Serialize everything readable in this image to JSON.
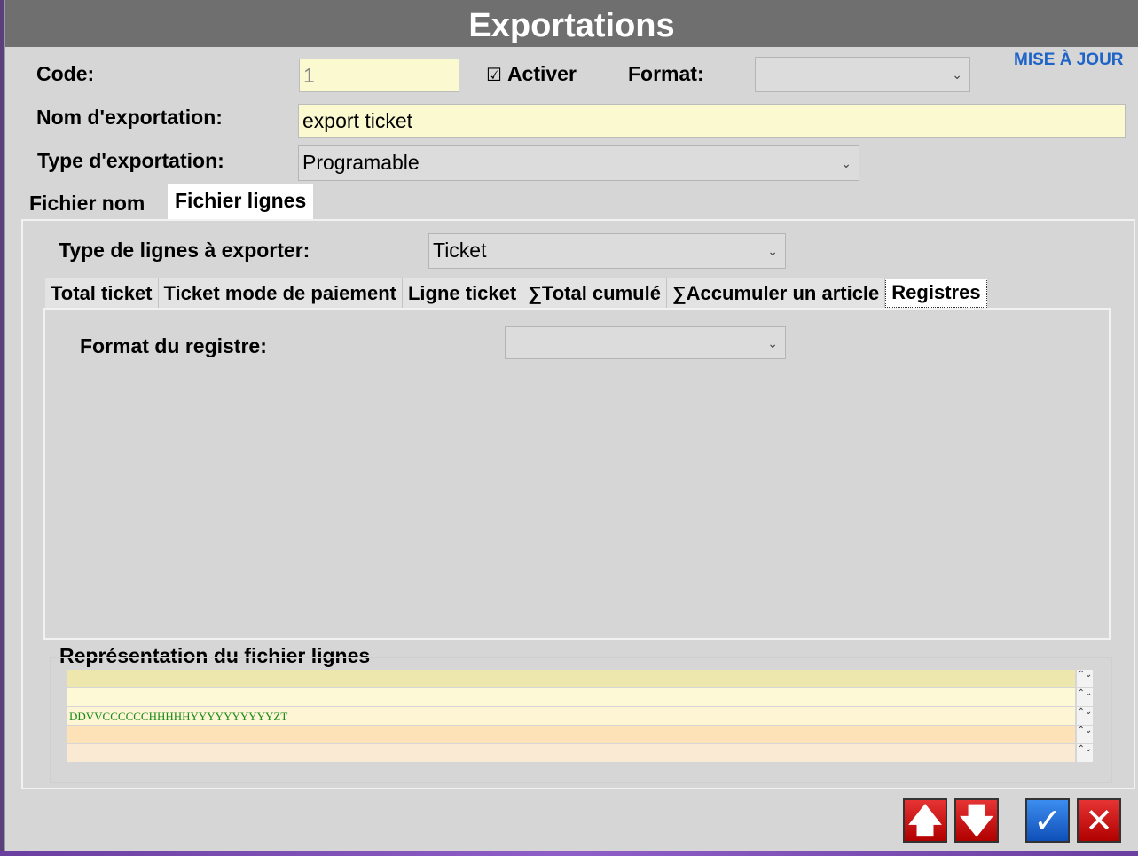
{
  "window": {
    "title": "Exportations"
  },
  "header": {
    "update_link": "MISE À JOUR",
    "code_label": "Code:",
    "code_value": "1",
    "activate_checkbox": "☑",
    "activate_label": "Activer",
    "format_label": "Format:",
    "format_value": "",
    "export_name_label": "Nom d'exportation:",
    "export_name_value": "export ticket",
    "export_type_label": "Type d'exportation:",
    "export_type_value": "Programable"
  },
  "top_tabs": [
    "Fichier nom",
    "Fichier lignes"
  ],
  "active_top_tab": "Fichier lignes",
  "lines_panel": {
    "line_type_label": "Type de lignes à exporter:",
    "line_type_value": "Ticket",
    "inner_tabs": [
      "Total ticket",
      "Ticket mode de paiement",
      "Ligne ticket",
      "∑Total cumulé",
      "∑Accumuler un article",
      "Registres"
    ],
    "active_inner_tab": "Registres",
    "register_format_label": "Format du registre:",
    "register_format_value": ""
  },
  "representation": {
    "title": "Représentation du fichier lignes",
    "rows": [
      {
        "text": "",
        "color": "#ede7ad"
      },
      {
        "text": "",
        "color": "#fdf8d6"
      },
      {
        "text": "DDVVCCCCCCHHHHHYYYYYYYYYYZT",
        "color": "#fdf5d3"
      },
      {
        "text": "",
        "color": "#fde2b8"
      },
      {
        "text": "",
        "color": "#faead4"
      }
    ],
    "spinner_glyphs": "⌃⌄"
  },
  "buttons": {
    "up_icon": "🡅",
    "down_icon": "🡇",
    "ok_icon": "✓",
    "cancel_icon": "✕"
  },
  "colors": {
    "title_bar": "#6f6f6f",
    "field_yellow": "#fbf9d0",
    "link_blue": "#1e64c8",
    "button_red": "#cc1111",
    "button_blue": "#1e6fd6"
  }
}
